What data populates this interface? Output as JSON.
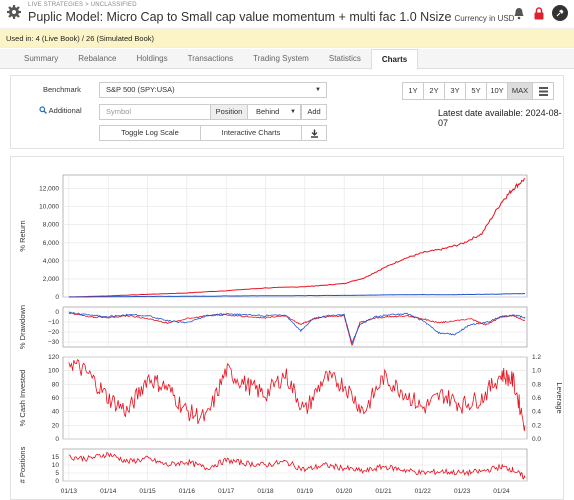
{
  "header": {
    "breadcrumb": "LIVE STRATEGIES > UNCLASSIFIED",
    "title": "Puplic Model: Micro Cap to Small cap value momentum + multi fac 1.0 Nsize",
    "currency": "Currency in USD",
    "icons": [
      "gear-icon",
      "bell-icon",
      "lock-icon",
      "pin-icon"
    ]
  },
  "used_in": "Used in: 4 (Live Book) / 26 (Simulated Book)",
  "tabs": [
    "Summary",
    "Rebalance",
    "Holdings",
    "Transactions",
    "Trading System",
    "Statistics",
    "Charts"
  ],
  "active_tab": "Charts",
  "controls": {
    "benchmark_label": "Benchmark",
    "benchmark_value": "S&P 500 (SPY:USA)",
    "additional_label": "Additional",
    "symbol_placeholder": "Symbol",
    "position_label": "Position",
    "behind_value": "Behind",
    "add_label": "Add",
    "toggle_log": "Toggle Log Scale",
    "interactive": "Interactive Charts",
    "periods": [
      "1Y",
      "2Y",
      "3Y",
      "5Y",
      "10Y",
      "MAX"
    ],
    "active_period": "MAX",
    "latest": "Latest date available: 2024-08-07"
  },
  "colors": {
    "model": "#e8101e",
    "benchmark": "#2255cc",
    "active_bg": "#dddddd"
  },
  "chart_data": [
    {
      "type": "line",
      "title": "",
      "ylabel": "% Return",
      "ylim": [
        0,
        13500
      ],
      "yticks": [
        "0",
        "2,000",
        "4,000",
        "6,000",
        "8,000",
        "10,000",
        "12,000"
      ],
      "x": [
        2013.0,
        2014.0,
        2015.0,
        2016.0,
        2017.0,
        2018.0,
        2019.0,
        2019.5,
        2020.0,
        2020.5,
        2021.0,
        2021.5,
        2022.0,
        2022.5,
        2023.0,
        2023.5,
        2024.0,
        2024.3,
        2024.6
      ],
      "series": [
        {
          "values": [
            0,
            120,
            300,
            450,
            700,
            1000,
            1150,
            1300,
            1500,
            2100,
            3200,
            4200,
            4900,
            5300,
            5900,
            7000,
            10500,
            12000,
            13100
          ]
        },
        {
          "values": [
            0,
            30,
            60,
            80,
            110,
            140,
            150,
            170,
            180,
            200,
            230,
            260,
            260,
            250,
            270,
            300,
            330,
            360,
            380
          ]
        }
      ]
    },
    {
      "type": "line",
      "ylabel": "% Drawdown",
      "ylim": [
        -35,
        5
      ],
      "yticks": [
        "0",
        "−10",
        "−20",
        "−30"
      ],
      "x": [
        2013.0,
        2013.5,
        2014.0,
        2014.5,
        2015.0,
        2015.5,
        2016.0,
        2016.5,
        2017.0,
        2017.5,
        2018.0,
        2018.5,
        2018.9,
        2019.2,
        2019.6,
        2020.0,
        2020.2,
        2020.4,
        2020.8,
        2021.2,
        2021.6,
        2022.0,
        2022.4,
        2022.8,
        2023.2,
        2023.6,
        2024.0,
        2024.3,
        2024.6
      ],
      "series": [
        {
          "values": [
            0,
            -4,
            -5,
            -3,
            -6,
            -10,
            -6,
            -3,
            -2,
            -4,
            -5,
            -3,
            -12,
            -6,
            -4,
            -3,
            -33,
            -10,
            -5,
            -4,
            -3,
            -6,
            -10,
            -8,
            -6,
            -12,
            -4,
            -3,
            -8
          ]
        },
        {
          "values": [
            0,
            -2,
            -4,
            -2,
            -3,
            -8,
            -10,
            -3,
            -1,
            -2,
            -3,
            -2,
            -18,
            -6,
            -3,
            -2,
            -30,
            -12,
            -4,
            -2,
            -1,
            -8,
            -20,
            -22,
            -12,
            -10,
            -4,
            -2,
            -5
          ]
        }
      ]
    },
    {
      "type": "line",
      "ylabel": "% Cash Invested",
      "ylabel_right": "Leverage",
      "ylim": [
        0,
        120
      ],
      "yticks": [
        "0",
        "20",
        "40",
        "60",
        "80",
        "100",
        "120"
      ],
      "yticks_right": [
        "0.0",
        "0.2",
        "0.4",
        "0.6",
        "0.8",
        "1.0",
        "1.2"
      ],
      "x": [
        2013.0,
        2013.5,
        2014.0,
        2014.5,
        2015.0,
        2015.5,
        2016.0,
        2016.5,
        2017.0,
        2017.5,
        2018.0,
        2018.5,
        2019.0,
        2019.5,
        2020.0,
        2020.5,
        2021.0,
        2021.5,
        2022.0,
        2022.5,
        2023.0,
        2023.5,
        2024.0,
        2024.3,
        2024.6
      ],
      "series": [
        {
          "values": [
            115,
            95,
            60,
            40,
            90,
            75,
            40,
            30,
            100,
            80,
            65,
            95,
            40,
            90,
            80,
            40,
            90,
            70,
            45,
            65,
            50,
            60,
            95,
            85,
            20
          ]
        }
      ]
    },
    {
      "type": "line",
      "ylabel": "# Positions",
      "ylim": [
        0,
        20
      ],
      "yticks": [
        "0",
        "5",
        "10",
        "15"
      ],
      "xticks": [
        "01/13",
        "01/14",
        "01/15",
        "01/16",
        "01/17",
        "01/18",
        "01/19",
        "01/20",
        "01/21",
        "01/22",
        "01/23",
        "01/24"
      ],
      "x": [
        2013.0,
        2013.5,
        2014.0,
        2014.5,
        2015.0,
        2015.5,
        2016.0,
        2016.5,
        2017.0,
        2017.5,
        2018.0,
        2018.5,
        2019.0,
        2019.5,
        2020.0,
        2020.5,
        2021.0,
        2021.5,
        2022.0,
        2022.5,
        2023.0,
        2023.5,
        2024.0,
        2024.3,
        2024.6
      ],
      "series": [
        {
          "values": [
            15,
            14,
            17,
            12,
            14,
            10,
            12,
            8,
            13,
            11,
            10,
            12,
            7,
            10,
            8,
            6,
            9,
            7,
            5,
            6,
            5,
            6,
            9,
            7,
            2
          ]
        }
      ]
    }
  ]
}
